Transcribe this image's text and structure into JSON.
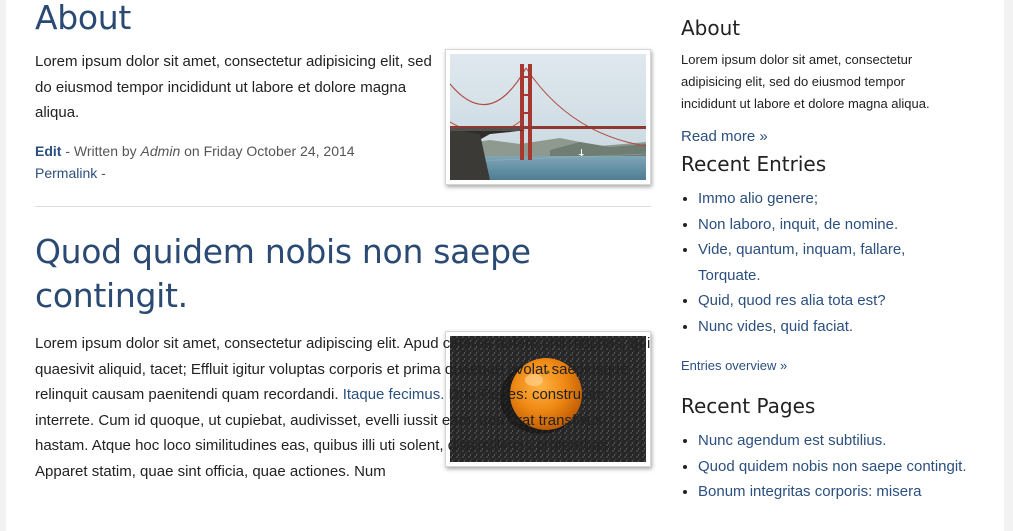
{
  "main": {
    "post1": {
      "title": "About",
      "text": "Lorem ipsum dolor sit amet, consectetur adipisicing elit, sed do eiusmod tempor incididunt ut labore et dolore magna aliqua.",
      "edit_label": "Edit",
      "written_by": " - Written by ",
      "author": "Admin",
      "on_date": " on Friday October 24, 2014",
      "permalink": "Permalink",
      "permalink_suffix": " -",
      "image_icon": "golden-gate-bridge-photo"
    },
    "post2": {
      "title": "Quod quidem nobis non saepe contingit.",
      "text_before_link": "Lorem ipsum dolor sit amet, consectetur adipiscing elit. Apud ceteros autem philosophos, qui quaesivit aliquid, tacet; Effluit igitur voluptas corporis et prima quaeque avolat saepiusque relinquit causam paenitendi quam recordandi. ",
      "link": "Itaque fecimus.",
      "text_after_link": " Duo Reges: constructio interrete. Cum id quoque, ut cupiebat, audivisset, evelli iussit eam, qua erat transfixus, hastam. Atque hoc loco similitudines eas, quibus illi uti solent, dissimillimas proferebas. Apparet statim, quae sint officia, quae actiones. Num",
      "image_icon": "orange-fruit-photo"
    }
  },
  "sidebar": {
    "about": {
      "heading": "About",
      "text": "Lorem ipsum dolor sit amet, consectetur adipisicing elit, sed do eiusmod tempor incididunt ut labore et dolore magna aliqua.",
      "read_more": "Read more »"
    },
    "recent_entries": {
      "heading": "Recent Entries",
      "items": [
        "Immo alio genere;",
        "Non laboro, inquit, de nomine.",
        "Vide, quantum, inquam, fallare, Torquate.",
        "Quid, quod res alia tota est?",
        "Nunc vides, quid faciat."
      ],
      "overview": "Entries overview »"
    },
    "recent_pages": {
      "heading": "Recent Pages",
      "items": [
        "Nunc agendum est subtilius.",
        "Quod quidem nobis non saepe contingit.",
        "Bonum integritas corporis: misera"
      ]
    }
  },
  "colors": {
    "link": "#2b4f7e",
    "title": "#2b4a73",
    "text": "#222222"
  }
}
